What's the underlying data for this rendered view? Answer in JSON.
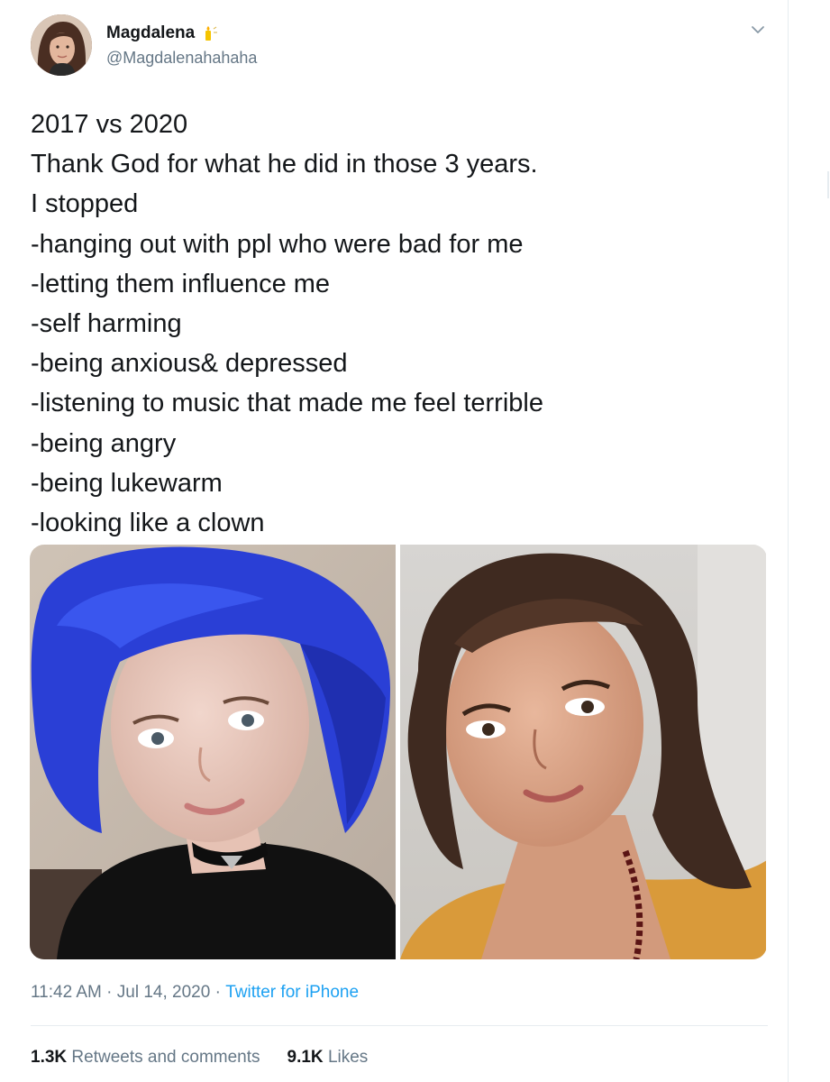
{
  "tweet": {
    "author": {
      "name": "Magdalena",
      "handle": "@Magdalenahahaha",
      "emoji_icon": "candle-icon"
    },
    "text_lines": [
      "2017 vs 2020",
      "Thank God for what he did in those 3 years.",
      "I stopped",
      "-hanging out with ppl who were bad for me",
      "-letting them influence me",
      "-self harming",
      "-being anxious& depressed",
      "-listening to music that made me feel terrible",
      "-being angry",
      "-being lukewarm",
      "-looking like a clown"
    ],
    "media": [
      {
        "label": "photo-2017"
      },
      {
        "label": "photo-2020"
      }
    ],
    "meta": {
      "time": "11:42 AM",
      "separator": " · ",
      "date": "Jul 14, 2020",
      "source": "Twitter for iPhone"
    },
    "stats": {
      "retweets_count": "1.3K",
      "retweets_label": "Retweets and comments",
      "likes_count": "9.1K",
      "likes_label": "Likes"
    }
  },
  "colors": {
    "text": "#14171a",
    "secondary": "#657786",
    "link": "#1da1f2",
    "divider": "#e6ecf0"
  }
}
